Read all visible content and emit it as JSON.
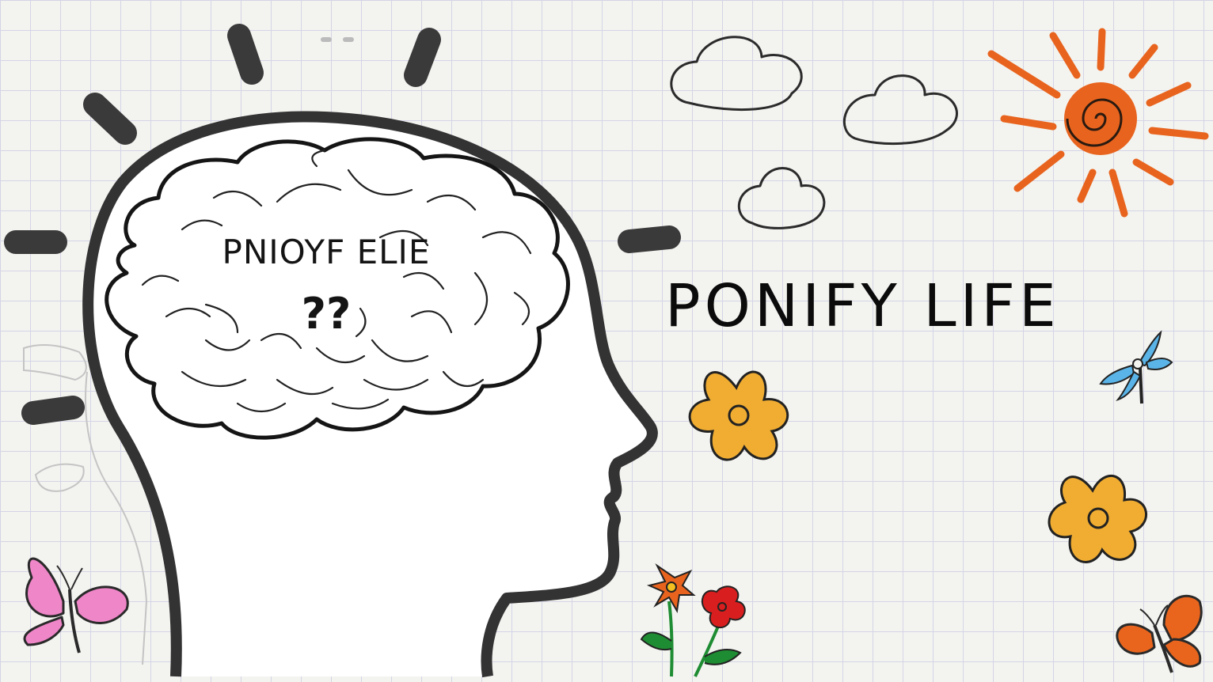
{
  "scene": {
    "brain_text": "PNIOYF ELIE",
    "brain_question": "??",
    "title": "PONIFY LIFE"
  },
  "colors": {
    "background": "#f3f4f0",
    "grid_line": "#d4d4e6",
    "outline": "#2e2e2e",
    "sun_orange": "#e8641e",
    "flower_yellow": "#f0ad32",
    "butterfly_pink": "#ef86c8",
    "butterfly_orange": "#e9651d",
    "dragonfly_blue": "#5ab4e8",
    "flower_red": "#d81e1e",
    "stem_green": "#1e8c32"
  },
  "icons": [
    "head-silhouette-icon",
    "brain-icon",
    "idea-ray-icon",
    "cloud-icon",
    "sun-icon",
    "flower-icon",
    "butterfly-icon",
    "dragonfly-icon"
  ]
}
